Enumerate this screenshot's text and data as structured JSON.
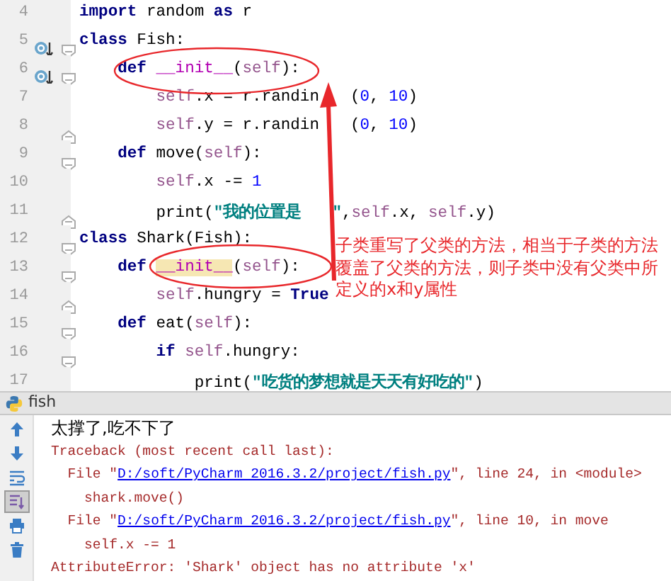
{
  "editor": {
    "lines": [
      {
        "number": "4",
        "tokens": [
          {
            "text": "import",
            "kind": "kw"
          },
          {
            "text": " random ",
            "kind": "plain"
          },
          {
            "text": "as",
            "kind": "kw"
          },
          {
            "text": " r",
            "kind": "plain"
          }
        ]
      },
      {
        "number": "5",
        "override_marker": true,
        "fold_open": true,
        "tokens": [
          {
            "text": "class",
            "kind": "kw"
          },
          {
            "text": " Fish:",
            "kind": "plain"
          }
        ]
      },
      {
        "number": "6",
        "override_marker": true,
        "fold_open": true,
        "tokens": [
          {
            "text": "    def",
            "kind": "kw"
          },
          {
            "text": " __init__",
            "kind": "magic",
            "highlighted": false
          },
          {
            "text": "(",
            "kind": "plain"
          },
          {
            "text": "self",
            "kind": "self"
          },
          {
            "text": "):",
            "kind": "plain"
          }
        ]
      },
      {
        "number": "7",
        "tokens": [
          {
            "text": "        self",
            "kind": "self"
          },
          {
            "text": ".x = r.randin",
            "kind": "plain"
          },
          {
            "kind": "gap"
          },
          {
            "text": "(",
            "kind": "plain"
          },
          {
            "text": "0",
            "kind": "num"
          },
          {
            "text": ", ",
            "kind": "plain"
          },
          {
            "text": "10",
            "kind": "num"
          },
          {
            "text": ")",
            "kind": "plain"
          }
        ]
      },
      {
        "number": "8",
        "fold_close": true,
        "tokens": [
          {
            "text": "        self",
            "kind": "self"
          },
          {
            "text": ".y = r.randin",
            "kind": "plain"
          },
          {
            "kind": "gap"
          },
          {
            "text": "(",
            "kind": "plain"
          },
          {
            "text": "0",
            "kind": "num"
          },
          {
            "text": ", ",
            "kind": "plain"
          },
          {
            "text": "10",
            "kind": "num"
          },
          {
            "text": ")",
            "kind": "plain"
          }
        ]
      },
      {
        "number": "9",
        "fold_open": true,
        "tokens": [
          {
            "text": "    def",
            "kind": "kw"
          },
          {
            "text": " move(",
            "kind": "plain"
          },
          {
            "text": "self",
            "kind": "self"
          },
          {
            "text": "):",
            "kind": "plain"
          }
        ]
      },
      {
        "number": "10",
        "tokens": [
          {
            "text": "        self",
            "kind": "self"
          },
          {
            "text": ".x -= ",
            "kind": "plain"
          },
          {
            "text": "1",
            "kind": "num"
          }
        ]
      },
      {
        "number": "11",
        "fold_close": true,
        "tokens": [
          {
            "text": "        print(",
            "kind": "plain"
          },
          {
            "text": "\"我的位置是",
            "kind": "str"
          },
          {
            "kind": "gap"
          },
          {
            "text": "\"",
            "kind": "str"
          },
          {
            "text": ",",
            "kind": "plain"
          },
          {
            "text": "self",
            "kind": "self"
          },
          {
            "text": ".x, ",
            "kind": "plain"
          },
          {
            "text": "self",
            "kind": "self"
          },
          {
            "text": ".y)",
            "kind": "plain"
          }
        ]
      },
      {
        "number": "12",
        "fold_open": true,
        "tokens": [
          {
            "text": "class",
            "kind": "kw"
          },
          {
            "text": " Shark(Fish):",
            "kind": "plain"
          }
        ]
      },
      {
        "number": "13",
        "fold_open": true,
        "tokens": [
          {
            "text": "    def ",
            "kind": "kw"
          },
          {
            "text": "__init__",
            "kind": "magic",
            "highlighted": true
          },
          {
            "text": "(",
            "kind": "plain"
          },
          {
            "text": "self",
            "kind": "self"
          },
          {
            "text": "):",
            "kind": "plain"
          }
        ]
      },
      {
        "number": "14",
        "fold_close": true,
        "tokens": [
          {
            "text": "        self",
            "kind": "self"
          },
          {
            "text": ".hungry = ",
            "kind": "plain"
          },
          {
            "text": "True",
            "kind": "kw"
          }
        ]
      },
      {
        "number": "15",
        "fold_open": true,
        "tokens": [
          {
            "text": "    def",
            "kind": "kw"
          },
          {
            "text": " eat(",
            "kind": "plain"
          },
          {
            "text": "self",
            "kind": "self"
          },
          {
            "text": "):",
            "kind": "plain"
          }
        ]
      },
      {
        "number": "16",
        "fold_open": true,
        "tokens": [
          {
            "text": "        if ",
            "kind": "kw"
          },
          {
            "text": "self",
            "kind": "self"
          },
          {
            "text": ".hungry:",
            "kind": "plain"
          }
        ]
      },
      {
        "number": "17",
        "tokens": [
          {
            "text": "            print(",
            "kind": "plain"
          },
          {
            "text": "\"吃货的梦想就是天天有好吃的\"",
            "kind": "str"
          },
          {
            "text": ")",
            "kind": "plain"
          }
        ]
      }
    ],
    "annotation": {
      "note": "子类重写了父类的方法，相当于子类的方法覆盖了父类的方法，则子类中没有父类中所定义的x和y属性"
    }
  },
  "console": {
    "tab": "fish",
    "tools": [
      {
        "kind": "up",
        "pressed": false
      },
      {
        "kind": "down",
        "pressed": false
      },
      {
        "kind": "wrap",
        "pressed": false
      },
      {
        "kind": "scroll",
        "pressed": true
      },
      {
        "kind": "print",
        "pressed": false
      },
      {
        "kind": "trash",
        "pressed": false
      }
    ],
    "lines": [
      {
        "kind": "stdout",
        "parts": [
          {
            "text": "太撑了,吃不下了",
            "kind": "text"
          }
        ]
      },
      {
        "kind": "stderr",
        "parts": [
          {
            "text": "Traceback (most recent call last):",
            "kind": "text"
          }
        ]
      },
      {
        "kind": "stderr",
        "parts": [
          {
            "text": "  File \"",
            "kind": "text"
          },
          {
            "text": "D:/soft/PyCharm 2016.3.2/project/fish.py",
            "kind": "link"
          },
          {
            "text": "\", line 24, in <module>",
            "kind": "text"
          }
        ]
      },
      {
        "kind": "stderr",
        "parts": [
          {
            "text": "    shark.move()",
            "kind": "text"
          }
        ]
      },
      {
        "kind": "stderr",
        "parts": [
          {
            "text": "  File \"",
            "kind": "text"
          },
          {
            "text": "D:/soft/PyCharm 2016.3.2/project/fish.py",
            "kind": "link"
          },
          {
            "text": "\", line 10, in move",
            "kind": "text"
          }
        ]
      },
      {
        "kind": "stderr",
        "parts": [
          {
            "text": "    self.x -= 1",
            "kind": "text"
          }
        ]
      },
      {
        "kind": "stderr",
        "parts": [
          {
            "text": "AttributeError: 'Shark' object has no attribute 'x'",
            "kind": "text"
          }
        ]
      }
    ]
  }
}
